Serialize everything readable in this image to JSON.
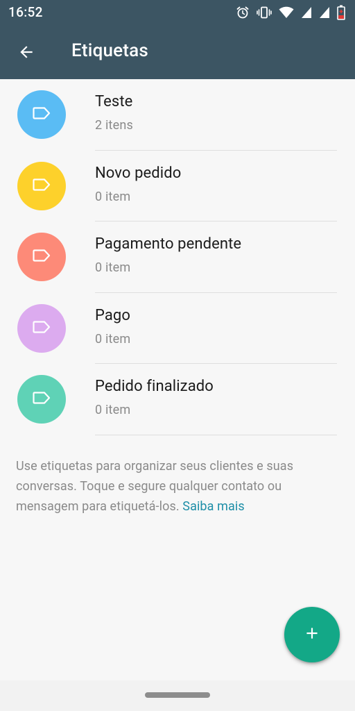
{
  "status_bar": {
    "time": "16:52",
    "icons": [
      "alarm-icon",
      "vibrate-icon",
      "wifi-icon",
      "signal-icon",
      "signal-icon",
      "battery-low-icon"
    ]
  },
  "app_bar": {
    "back_icon": "arrow-back-icon",
    "title": "Etiquetas"
  },
  "labels": [
    {
      "name": "Teste",
      "count": "2 itens",
      "color": "#5abcf4",
      "icon": "label-tag-icon"
    },
    {
      "name": "Novo pedido",
      "count": "0 item",
      "color": "#fdd12b",
      "icon": "label-tag-icon"
    },
    {
      "name": "Pagamento pendente",
      "count": "0 item",
      "color": "#fd8a78",
      "icon": "label-tag-icon"
    },
    {
      "name": "Pago",
      "count": "0 item",
      "color": "#dcabef",
      "icon": "label-tag-icon"
    },
    {
      "name": "Pedido finalizado",
      "count": "0 item",
      "color": "#5fd2b6",
      "icon": "label-tag-icon"
    }
  ],
  "info": {
    "text": "Use etiquetas para organizar seus clientes e suas conversas. Toque e segure qualquer contato ou mensagem para etiquetá-los.",
    "link": "Saiba mais"
  },
  "fab": {
    "icon": "plus-icon",
    "color": "#13a887"
  },
  "colors": {
    "toolbar": "#3c5563",
    "background": "#f7f7f7",
    "link": "#1d8ea7"
  }
}
